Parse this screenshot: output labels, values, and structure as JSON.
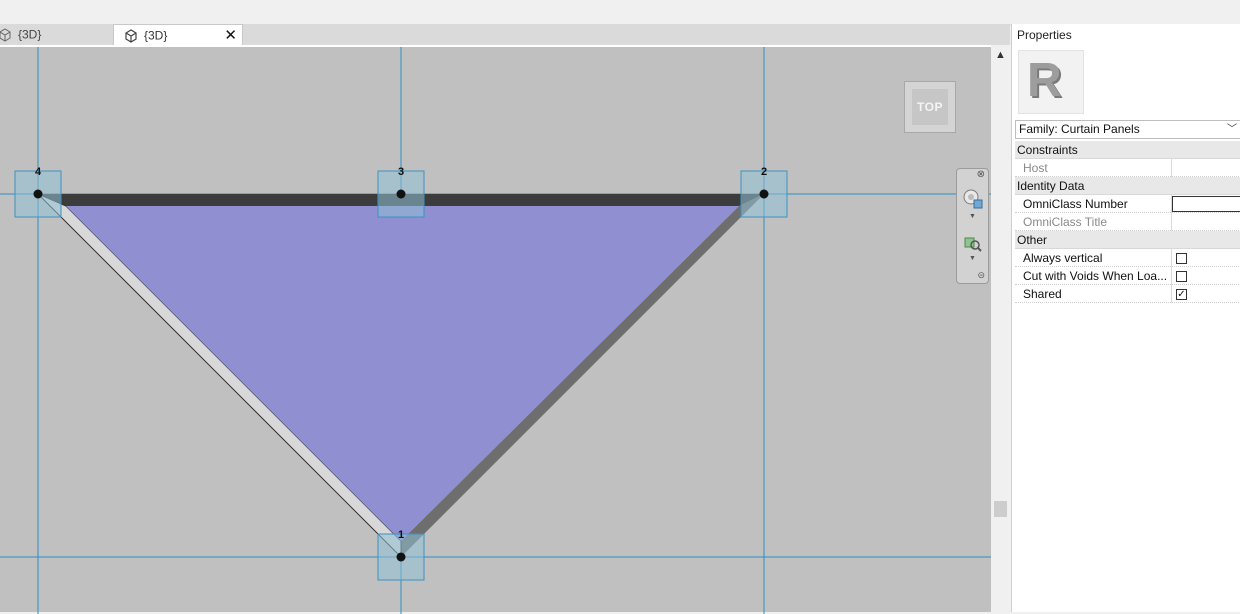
{
  "tabs": [
    {
      "label": "{3D}",
      "active": false
    },
    {
      "label": "{3D}",
      "active": true
    }
  ],
  "tab_close_icon": "close-icon",
  "viewcube": {
    "face_label": "TOP"
  },
  "reference_points": [
    "1",
    "2",
    "3",
    "4"
  ],
  "colors": {
    "panel_fill": "#8f8fd1",
    "grid_line": "#1f8fc4",
    "viewport_bg": "#c0c0c0",
    "selection_box": "#8fbfd6"
  },
  "properties": {
    "title": "Properties",
    "family_selector": "Family: Curtain Panels",
    "groups": [
      {
        "label": "Constraints",
        "items": [
          {
            "name": "Host",
            "type": "text",
            "value": "",
            "enabled": false
          }
        ]
      },
      {
        "label": "Identity Data",
        "items": [
          {
            "name": "OmniClass Number",
            "type": "textbox",
            "value": "",
            "enabled": true
          },
          {
            "name": "OmniClass Title",
            "type": "text",
            "value": "",
            "enabled": false
          }
        ]
      },
      {
        "label": "Other",
        "items": [
          {
            "name": "Always vertical",
            "type": "checkbox",
            "checked": false,
            "enabled": true
          },
          {
            "name": "Cut with Voids When Loa...",
            "type": "checkbox",
            "checked": false,
            "enabled": true
          },
          {
            "name": "Shared",
            "type": "checkbox",
            "checked": true,
            "enabled": true
          }
        ]
      }
    ]
  }
}
